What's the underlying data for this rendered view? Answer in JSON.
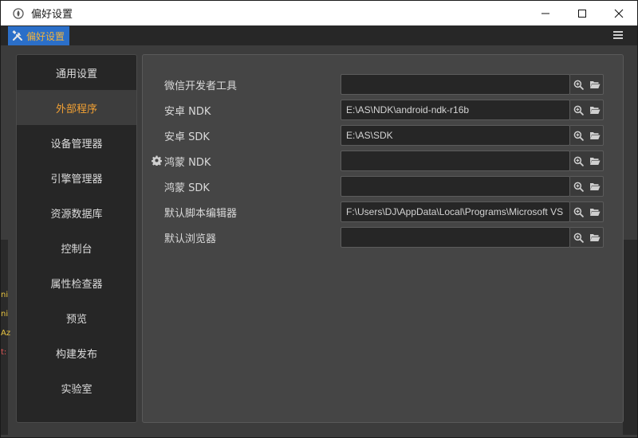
{
  "window": {
    "title": "偏好设置",
    "app_icon": "app-logo-icon",
    "controls": [
      "minimize-icon",
      "maximize-icon",
      "close-icon"
    ]
  },
  "tab": {
    "label": "偏好设置",
    "icon": "tools-icon"
  },
  "sidebar": {
    "items": [
      {
        "label": "通用设置",
        "active": false
      },
      {
        "label": "外部程序",
        "active": true
      },
      {
        "label": "设备管理器",
        "active": false
      },
      {
        "label": "引擎管理器",
        "active": false
      },
      {
        "label": "资源数据库",
        "active": false
      },
      {
        "label": "控制台",
        "active": false
      },
      {
        "label": "属性检查器",
        "active": false
      },
      {
        "label": "预览",
        "active": false
      },
      {
        "label": "构建发布",
        "active": false
      },
      {
        "label": "实验室",
        "active": false
      }
    ]
  },
  "settings": {
    "rows": [
      {
        "label": "微信开发者工具",
        "value": "",
        "has_gear": false
      },
      {
        "label": "安卓 NDK",
        "value": "E:\\AS\\NDK\\android-ndk-r16b",
        "has_gear": false
      },
      {
        "label": "安卓 SDK",
        "value": "E:\\AS\\SDK",
        "has_gear": false
      },
      {
        "label": "鸿蒙 NDK",
        "value": "",
        "has_gear": true
      },
      {
        "label": "鸿蒙 SDK",
        "value": "",
        "has_gear": false
      },
      {
        "label": "默认脚本编辑器",
        "value": "F:\\Users\\DJ\\AppData\\Local\\Programs\\Microsoft VS Code\\Code.exe",
        "has_gear": false
      },
      {
        "label": "默认浏览器",
        "value": "",
        "has_gear": false
      }
    ],
    "row_icons": [
      "search-zoom-icon",
      "folder-open-icon"
    ]
  },
  "background": {
    "left_fragments": [
      "ni",
      "ni",
      "Az",
      "t:"
    ]
  },
  "colors": {
    "accent_orange": "#f3a133",
    "tab_blue": "#2b6fc9",
    "panel_bg": "#454545",
    "sidebar_bg": "#262626"
  }
}
